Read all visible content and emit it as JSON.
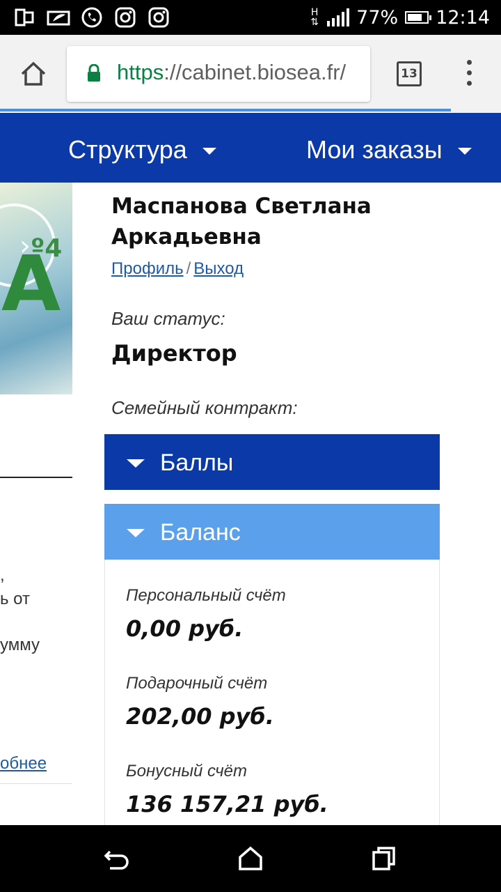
{
  "status_bar": {
    "network": "H",
    "battery": "77%",
    "battery_level": 0.77,
    "time": "12:14",
    "notification_icons": [
      "dual-window-icon",
      "message-icon",
      "whatsapp-icon",
      "instagram-icon",
      "instagram-icon"
    ]
  },
  "browser": {
    "url_scheme": "https",
    "url_rest": "://cabinet.biosea.fr/",
    "tab_count": "13",
    "load_progress": 0.9
  },
  "nav": {
    "items": [
      {
        "label": "Структура"
      },
      {
        "label": "Мои заказы"
      }
    ]
  },
  "left_column": {
    "lines": [
      ",",
      "ь от",
      "умму"
    ],
    "link": "обнее"
  },
  "profile": {
    "name": "Маспанова Светлана Аркадьевна",
    "profile_link": "Профиль",
    "separator": "/",
    "logout_link": "Выход",
    "status_label": "Ваш статус:",
    "status_value": "Директор",
    "contract_label": "Семейный контракт:"
  },
  "accordions": {
    "points": "Баллы",
    "balance": "Баланс"
  },
  "balance": {
    "accounts": [
      {
        "label": "Персональный счёт",
        "value": "0,00 руб."
      },
      {
        "label": "Подарочный счёт",
        "value": "202,00 руб."
      },
      {
        "label": "Бонусный счёт",
        "value": "136 157,21 руб."
      }
    ]
  },
  "colors": {
    "nav_blue": "#0b3aa8",
    "accordion_light_blue": "#5aa0ea",
    "link_blue": "#1f5aa6",
    "secure_green": "#0b8043"
  }
}
